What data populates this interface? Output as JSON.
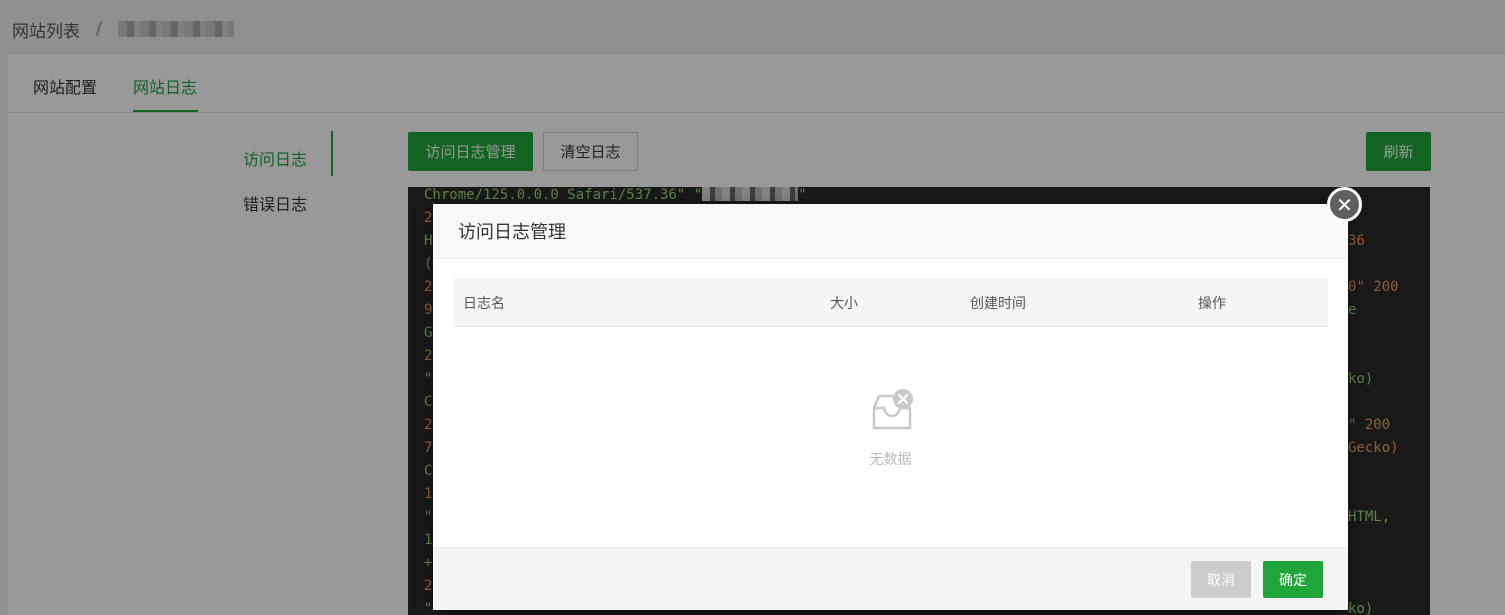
{
  "breadcrumb": {
    "root": "网站列表",
    "separator": "/"
  },
  "tabs": [
    {
      "label": "网站配置"
    },
    {
      "label": "网站日志"
    }
  ],
  "subnav": [
    {
      "label": "访问日志"
    },
    {
      "label": "错误日志"
    }
  ],
  "toolbar": {
    "manage_label": "访问日志管理",
    "clear_label": "清空日志",
    "refresh_label": "刷新"
  },
  "log": {
    "first_line": "Chrome/125.0.0.0 Safari/537.36\" \"",
    "first_line_end": "\"",
    "left_chars": [
      "2",
      "H",
      "(",
      "2",
      "9",
      "G",
      "2",
      "\"",
      "C",
      "2",
      "7",
      "C",
      "1",
      "\"",
      "1",
      "+",
      "2",
      "\""
    ],
    "right_fragments": [
      "36",
      "0\" 200",
      "e",
      "ko)",
      "\" 200",
      "Gecko)",
      "HTML,",
      "ko)"
    ]
  },
  "dialog": {
    "title": "访问日志管理",
    "close_icon": "close-icon",
    "columns": [
      "日志名",
      "大小",
      "创建时间",
      "操作"
    ],
    "empty_text": "无数据",
    "cancel_label": "取消",
    "ok_label": "确定"
  },
  "colors": {
    "accent": "#20a53a",
    "log_bg": "#2b2b2b",
    "log_green": "#9bdf6f",
    "log_orange": "#f0a45a"
  }
}
